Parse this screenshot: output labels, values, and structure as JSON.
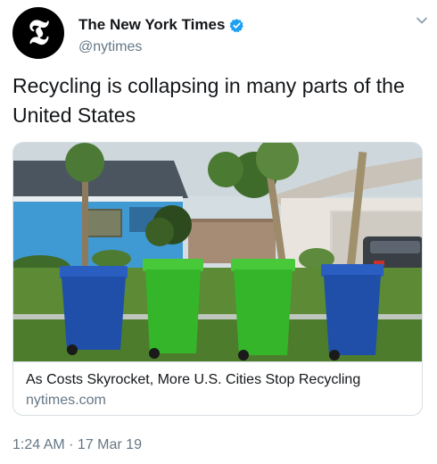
{
  "account": {
    "display_name": "The New York Times",
    "handle": "@nytimes",
    "avatar_glyph": "𝕿"
  },
  "tweet": {
    "text": "Recycling is collapsing in many parts of the United States",
    "timestamp": "1:24 AM · 17 Mar 19"
  },
  "card": {
    "title": "As Costs Skyrocket, More U.S. Cities Stop Recycling",
    "domain": "nytimes.com"
  },
  "colors": {
    "verified": "#1da1f2",
    "secondary_text": "#657786",
    "bin_blue": "#1f4fa8",
    "bin_green": "#35b52a"
  }
}
